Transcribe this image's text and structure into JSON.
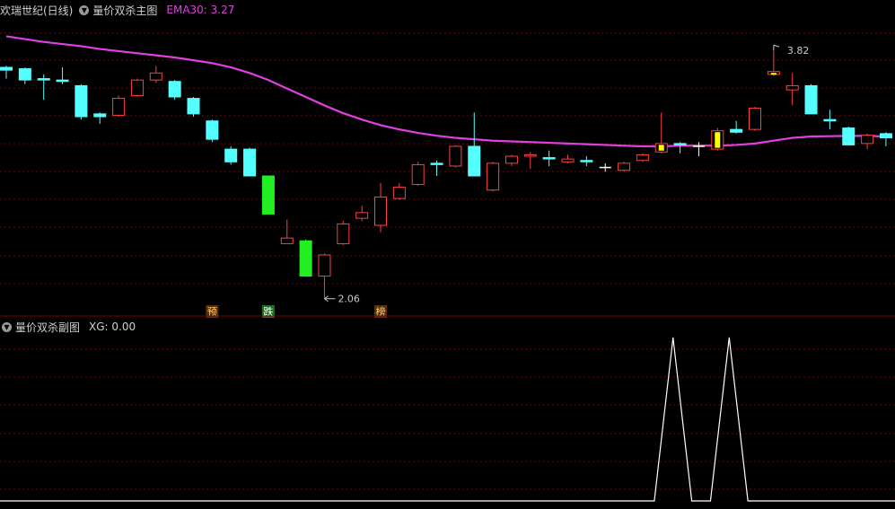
{
  "main": {
    "title": "欢瑞世纪(日线)",
    "formula": "量价双杀主图",
    "ema_label": "EMA30: 3.27",
    "high_label": "3.82",
    "low_label": "2.06",
    "signals": [
      {
        "text": "预",
        "color": "#ffcc66",
        "bg": "#5a3010",
        "k": 11
      },
      {
        "text": "跌",
        "color": "#ffffff",
        "bg": "#207020",
        "k": 14
      },
      {
        "text": "榜",
        "color": "#ffcc66",
        "bg": "#5a3010",
        "k": 20
      }
    ]
  },
  "sub": {
    "formula": "量价双杀副图",
    "xg_label": "XG: 0.00"
  },
  "colors": {
    "up": "#ff4040",
    "down": "#54ffff",
    "signal_green": "#22ee22",
    "signal_yellow": "#ffff00",
    "ema": "#e040e0",
    "grid": "#7a0000",
    "line": "#ffffff"
  },
  "chart_data": [
    {
      "type": "candlestick",
      "title": "量价双杀主图",
      "ylim": [
        1.95,
        4.05
      ],
      "candles": [
        {
          "o": 3.7,
          "c": 3.68,
          "h": 3.71,
          "l": 3.62,
          "col": "down"
        },
        {
          "o": 3.69,
          "c": 3.61,
          "h": 3.7,
          "l": 3.58,
          "col": "down"
        },
        {
          "o": 3.62,
          "c": 3.61,
          "h": 3.65,
          "l": 3.47,
          "col": "down"
        },
        {
          "o": 3.61,
          "c": 3.6,
          "h": 3.7,
          "l": 3.58,
          "col": "down"
        },
        {
          "o": 3.57,
          "c": 3.35,
          "h": 3.58,
          "l": 3.33,
          "col": "down"
        },
        {
          "o": 3.37,
          "c": 3.35,
          "h": 3.38,
          "l": 3.3,
          "col": "down"
        },
        {
          "o": 3.36,
          "c": 3.48,
          "h": 3.5,
          "l": 3.35,
          "col": "up"
        },
        {
          "o": 3.5,
          "c": 3.61,
          "h": 3.62,
          "l": 3.49,
          "col": "up"
        },
        {
          "o": 3.61,
          "c": 3.66,
          "h": 3.71,
          "l": 3.59,
          "col": "up"
        },
        {
          "o": 3.6,
          "c": 3.49,
          "h": 3.61,
          "l": 3.47,
          "col": "down"
        },
        {
          "o": 3.48,
          "c": 3.37,
          "h": 3.49,
          "l": 3.35,
          "col": "down"
        },
        {
          "o": 3.32,
          "c": 3.19,
          "h": 3.33,
          "l": 3.17,
          "col": "down"
        },
        {
          "o": 3.12,
          "c": 3.03,
          "h": 3.14,
          "l": 3.01,
          "col": "down"
        },
        {
          "o": 3.12,
          "c": 2.93,
          "h": 3.13,
          "l": 2.93,
          "col": "down"
        },
        {
          "o": 2.93,
          "c": 2.66,
          "h": 2.93,
          "l": 2.66,
          "col": "signal_green"
        },
        {
          "o": 2.45,
          "c": 2.49,
          "h": 2.62,
          "l": 2.45,
          "col": "up"
        },
        {
          "o": 2.47,
          "c": 2.22,
          "h": 2.48,
          "l": 2.22,
          "col": "signal_green"
        },
        {
          "o": 2.22,
          "c": 2.37,
          "h": 2.38,
          "l": 2.06,
          "col": "up"
        },
        {
          "o": 2.45,
          "c": 2.59,
          "h": 2.61,
          "l": 2.44,
          "col": "up"
        },
        {
          "o": 2.63,
          "c": 2.67,
          "h": 2.72,
          "l": 2.61,
          "col": "up"
        },
        {
          "o": 2.58,
          "c": 2.78,
          "h": 2.88,
          "l": 2.53,
          "col": "up"
        },
        {
          "o": 2.77,
          "c": 2.85,
          "h": 2.88,
          "l": 2.76,
          "col": "up"
        },
        {
          "o": 2.87,
          "c": 3.01,
          "h": 3.03,
          "l": 2.86,
          "col": "up"
        },
        {
          "o": 3.02,
          "c": 3.02,
          "h": 3.04,
          "l": 2.93,
          "col": "down"
        },
        {
          "o": 3.0,
          "c": 3.14,
          "h": 3.15,
          "l": 2.99,
          "col": "up"
        },
        {
          "o": 3.14,
          "c": 2.93,
          "h": 3.38,
          "l": 2.93,
          "col": "down"
        },
        {
          "o": 2.83,
          "c": 3.02,
          "h": 3.03,
          "l": 2.82,
          "col": "up"
        },
        {
          "o": 3.02,
          "c": 3.07,
          "h": 3.08,
          "l": 3.0,
          "col": "up"
        },
        {
          "o": 3.07,
          "c": 3.08,
          "h": 3.1,
          "l": 2.98,
          "col": "up"
        },
        {
          "o": 3.06,
          "c": 3.06,
          "h": 3.11,
          "l": 3.0,
          "col": "down"
        },
        {
          "o": 3.03,
          "c": 3.05,
          "h": 3.08,
          "l": 3.02,
          "col": "up"
        },
        {
          "o": 3.04,
          "c": 3.04,
          "h": 3.07,
          "l": 3.0,
          "col": "down"
        },
        {
          "o": 2.99,
          "c": 2.99,
          "h": 3.02,
          "l": 2.96,
          "col": "line"
        },
        {
          "o": 2.97,
          "c": 3.02,
          "h": 3.03,
          "l": 2.96,
          "col": "up"
        },
        {
          "o": 3.04,
          "c": 3.08,
          "h": 3.09,
          "l": 3.03,
          "col": "up"
        },
        {
          "o": 3.1,
          "c": 3.16,
          "h": 3.38,
          "l": 3.09,
          "col": "signal_yellow"
        },
        {
          "o": 3.15,
          "c": 3.16,
          "h": 3.17,
          "l": 3.09,
          "col": "down"
        },
        {
          "o": 3.14,
          "c": 3.14,
          "h": 3.17,
          "l": 3.07,
          "col": "line"
        },
        {
          "o": 3.12,
          "c": 3.25,
          "h": 3.27,
          "l": 3.11,
          "col": "signal_yellow"
        },
        {
          "o": 3.26,
          "c": 3.24,
          "h": 3.32,
          "l": 3.23,
          "col": "down"
        },
        {
          "o": 3.26,
          "c": 3.41,
          "h": 3.42,
          "l": 3.25,
          "col": "up"
        },
        {
          "o": 3.65,
          "c": 3.67,
          "h": 3.82,
          "l": 3.64,
          "col": "signal_yellow"
        },
        {
          "o": 3.54,
          "c": 3.57,
          "h": 3.66,
          "l": 3.43,
          "col": "up"
        },
        {
          "o": 3.57,
          "c": 3.37,
          "h": 3.58,
          "l": 3.37,
          "col": "down"
        },
        {
          "o": 3.33,
          "c": 3.32,
          "h": 3.4,
          "l": 3.26,
          "col": "down"
        },
        {
          "o": 3.27,
          "c": 3.15,
          "h": 3.28,
          "l": 3.15,
          "col": "down"
        },
        {
          "o": 3.16,
          "c": 3.22,
          "h": 3.23,
          "l": 3.12,
          "col": "up"
        },
        {
          "o": 3.23,
          "c": 3.2,
          "h": 3.24,
          "l": 3.14,
          "col": "down"
        }
      ],
      "ema30": [
        3.92,
        3.9,
        3.88,
        3.865,
        3.85,
        3.83,
        3.815,
        3.8,
        3.785,
        3.77,
        3.75,
        3.73,
        3.7,
        3.66,
        3.61,
        3.55,
        3.49,
        3.43,
        3.375,
        3.33,
        3.29,
        3.26,
        3.235,
        3.215,
        3.2,
        3.19,
        3.18,
        3.175,
        3.17,
        3.165,
        3.16,
        3.155,
        3.15,
        3.145,
        3.14,
        3.14,
        3.145,
        3.145,
        3.145,
        3.15,
        3.16,
        3.18,
        3.2,
        3.21,
        3.212,
        3.214,
        3.214,
        3.21
      ]
    },
    {
      "type": "line",
      "title": "量价双杀副图",
      "series": [
        {
          "name": "XG",
          "values": [
            0,
            0,
            0,
            0,
            0,
            0,
            0,
            0,
            0,
            0,
            0,
            0,
            0,
            0,
            0,
            0,
            0,
            0,
            0,
            0,
            0,
            0,
            0,
            0,
            0,
            0,
            0,
            0,
            0,
            0,
            0,
            0,
            0,
            0,
            0,
            1,
            0,
            0,
            1,
            0,
            0,
            0,
            0,
            0,
            0,
            0,
            0,
            0
          ]
        }
      ],
      "ylim": [
        0,
        1
      ]
    }
  ]
}
